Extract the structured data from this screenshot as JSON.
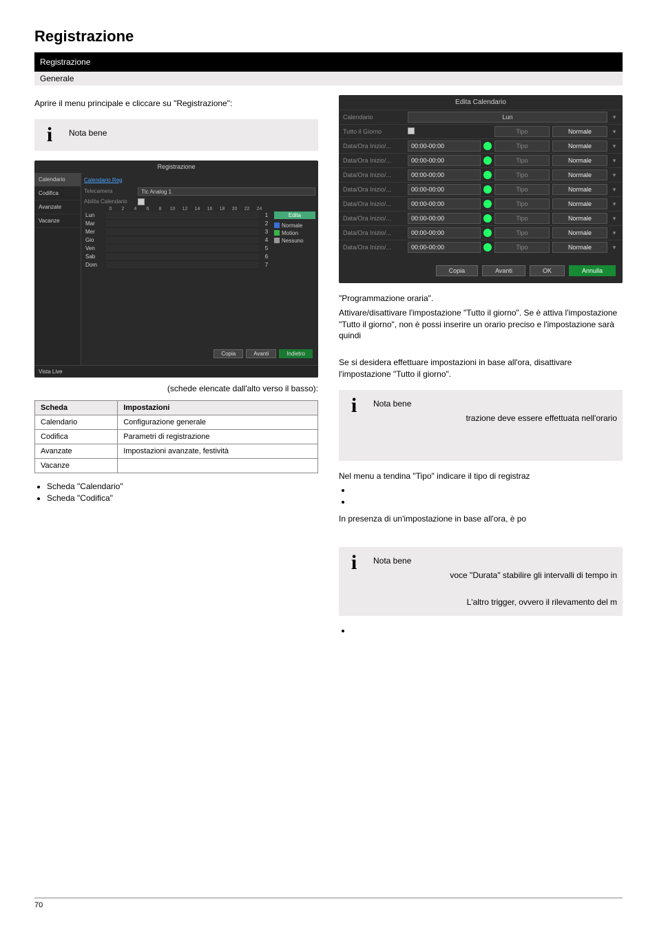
{
  "header": {
    "title": "Registrazione"
  },
  "black_bar": "Registrazione",
  "gray_bar": "Generale",
  "left": {
    "p1": "Aprire il menu principale e cliccare su \"Registrazione\":",
    "info1": "Nota bene",
    "info1_body": "",
    "caption1": "(schede elencate dall'alto verso il basso):",
    "table": {
      "h1": "Scheda",
      "h2": "Impostazioni",
      "r1a": "Calendario",
      "r1b": "Configurazione generale",
      "r2a": "Codifica",
      "r2b": "Parametri di registrazione",
      "r3a": "Avanzate",
      "r3b": "Impostazioni avanzate, festività",
      "r4a": "Vacanze",
      "r4b": ""
    },
    "b1": "Scheda \"Calendario\"",
    "b2": "Scheda \"Codifica\""
  },
  "panel": {
    "title": "Edita Calendario",
    "cal_label": "Calendario",
    "cal_val": "Lun",
    "allday_label": "Tutto il Giorno",
    "allday_tipo": "Tipo",
    "allday_norm": "Normale",
    "row_label": "Data/Ora Inizio/...",
    "row_time": "00:00-00:00",
    "row_tipo": "Tipo",
    "row_norm": "Normale",
    "btn_copia": "Copia",
    "btn_avanti": "Avanti",
    "btn_ok": "OK",
    "btn_annulla": "Annulla"
  },
  "right": {
    "p1": " \"Programmazione oraria\".",
    "p2": "Attivare/disattivare l'impostazione \"Tutto il giorno\". Se è attiva l'impostazione \"Tutto il giorno\", non è possi inserire un orario preciso e l'impostazione sarà quindi",
    "p3": "Se si desidera effettuare impostazioni in base all'ora, disattivare l'impostazione \"Tutto il giorno\".",
    "info2_title": "Nota bene",
    "info2_body": "trazione deve essere effettuata nell'orario",
    "p4": "Nel menu a tendina \"Tipo\" indicare il tipo di registraz",
    "li1": "",
    "li2": "",
    "p5": "In presenza di un'impostazione in base all'ora, è po",
    "info3_title": "Nota bene",
    "info3_body": "voce \"Durata\" stabilire gli intervalli di tempo in",
    "info3_body2": "L'altro trigger, ovvero il rilevamento del m",
    "li3": ""
  },
  "ss": {
    "title": "Registrazione",
    "side": {
      "s1": "Calendario",
      "s2": "Codifica",
      "s3": "Avanzate",
      "s4": "Vacanze",
      "live": "Vista Live"
    },
    "tab": "Calendario Reg",
    "tel_label": "Telecamera",
    "tel_val": "Tlc Analog 1",
    "ab_label": "Abilita Calendario",
    "days": {
      "d1": "Lun",
      "d2": "Mar",
      "d3": "Mer",
      "d4": "Gio",
      "d5": "Ven",
      "d6": "Sab",
      "d7": "Dom"
    },
    "hours": [
      "0",
      "2",
      "4",
      "6",
      "8",
      "10",
      "12",
      "14",
      "16",
      "18",
      "20",
      "22",
      "24"
    ],
    "nums": [
      "1",
      "2",
      "3",
      "4",
      "5",
      "6",
      "7"
    ],
    "edit": "Edita",
    "leg1": "Normale",
    "leg2": "Motion",
    "leg3": "Nessuno",
    "btn_copia": "Copia",
    "btn_avanti": "Avanti",
    "btn_indietro": "Indietro"
  },
  "footer": {
    "page": "70",
    "right": ""
  }
}
